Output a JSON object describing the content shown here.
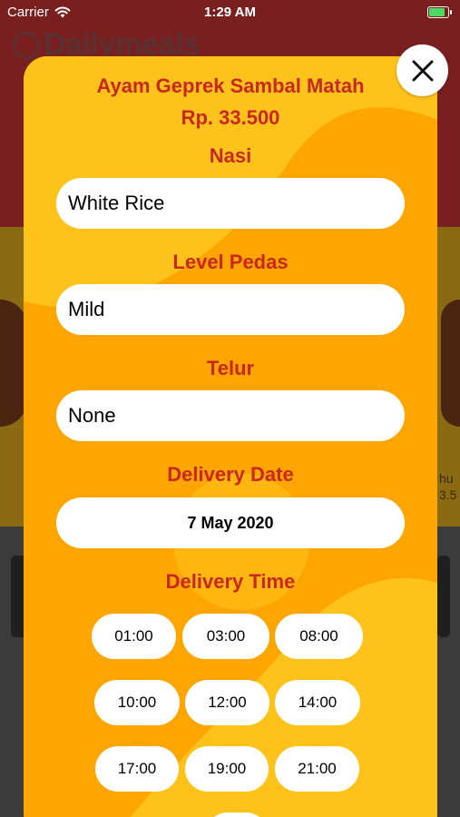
{
  "status_bar": {
    "carrier": "Carrier",
    "time": "1:29 AM",
    "wifi_icon": "wifi-icon",
    "battery_icon": "battery-charging-icon"
  },
  "background": {
    "app_name": "Dailymeals",
    "peek_text_1": "hu",
    "peek_text_2": "3.5"
  },
  "modal": {
    "dish_name": "Ayam Geprek Sambal Matah",
    "price": "Rp. 33.500",
    "fields": [
      {
        "label": "Nasi",
        "value": "White Rice"
      },
      {
        "label": "Level Pedas",
        "value": "Mild"
      },
      {
        "label": "Telur",
        "value": "None"
      },
      {
        "label": "Delivery Date",
        "value": "7 May 2020"
      }
    ],
    "delivery_time_label": "Delivery Time",
    "times": [
      "01:00",
      "03:00",
      "08:00",
      "10:00",
      "12:00",
      "14:00",
      "17:00",
      "19:00",
      "21:00"
    ]
  },
  "close_icon": "close-icon",
  "colors": {
    "modal_background": "#ffa500",
    "label_red": "#c8281e",
    "decor_yellow": "#ffc21a"
  }
}
